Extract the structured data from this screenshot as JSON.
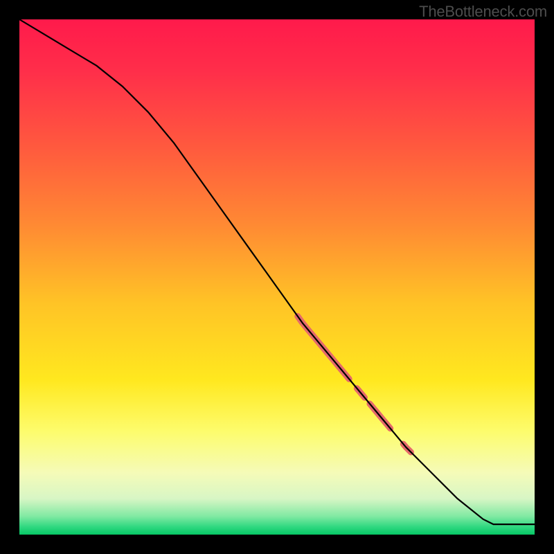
{
  "watermark": "TheBottleneck.com",
  "gradient": {
    "stops": [
      {
        "offset": 0.0,
        "color": "#ff1a4b"
      },
      {
        "offset": 0.1,
        "color": "#ff2e4a"
      },
      {
        "offset": 0.25,
        "color": "#ff5a3e"
      },
      {
        "offset": 0.4,
        "color": "#ff8a33"
      },
      {
        "offset": 0.55,
        "color": "#ffc326"
      },
      {
        "offset": 0.7,
        "color": "#ffe81f"
      },
      {
        "offset": 0.8,
        "color": "#fdfc6d"
      },
      {
        "offset": 0.88,
        "color": "#f5fbb8"
      },
      {
        "offset": 0.93,
        "color": "#d8f6c5"
      },
      {
        "offset": 0.965,
        "color": "#7fe9a2"
      },
      {
        "offset": 0.985,
        "color": "#2fd880"
      },
      {
        "offset": 1.0,
        "color": "#07c765"
      }
    ]
  },
  "chart_data": {
    "type": "line",
    "title": "",
    "xlabel": "",
    "ylabel": "",
    "xlim": [
      0,
      100
    ],
    "ylim": [
      0,
      100
    ],
    "grid": false,
    "series": [
      {
        "name": "curve",
        "x": [
          0,
          5,
          10,
          15,
          20,
          25,
          30,
          35,
          40,
          45,
          50,
          55,
          60,
          65,
          70,
          75,
          80,
          85,
          90,
          92,
          96,
          100
        ],
        "y": [
          100,
          97,
          94,
          91,
          87,
          82,
          76,
          69,
          62,
          55,
          48,
          41,
          35,
          29,
          23,
          17,
          12,
          7,
          3,
          2,
          2,
          2
        ]
      }
    ],
    "highlight_segments": [
      {
        "x0": 54,
        "x1": 64,
        "width": 9
      },
      {
        "x0": 65.5,
        "x1": 67,
        "width": 9
      },
      {
        "x0": 68,
        "x1": 72,
        "width": 9
      },
      {
        "x0": 74.5,
        "x1": 76,
        "width": 9
      }
    ],
    "highlight_color": "#e46a6a",
    "line_color": "#000000",
    "line_width": 2.2
  }
}
